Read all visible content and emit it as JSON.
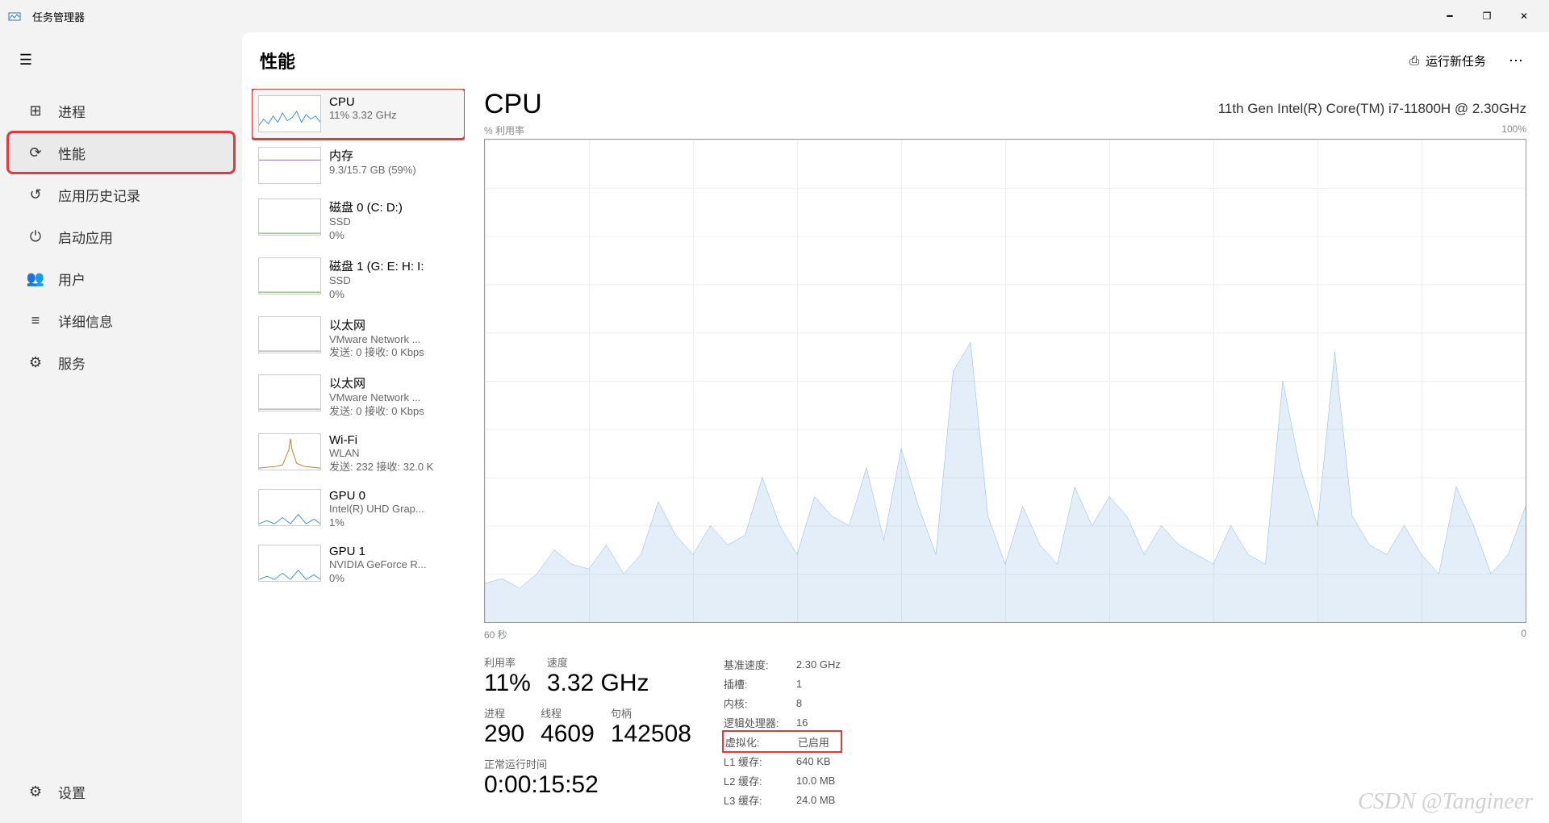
{
  "titlebar": {
    "app_title": "任务管理器"
  },
  "sidebar": {
    "items": [
      {
        "label": "进程"
      },
      {
        "label": "性能"
      },
      {
        "label": "应用历史记录"
      },
      {
        "label": "启动应用"
      },
      {
        "label": "用户"
      },
      {
        "label": "详细信息"
      },
      {
        "label": "服务"
      }
    ],
    "settings": "设置"
  },
  "header": {
    "page_title": "性能",
    "run_task": "运行新任务"
  },
  "perf_list": [
    {
      "title": "CPU",
      "sub": "11%  3.32 GHz",
      "color": "#3a8fd6"
    },
    {
      "title": "内存",
      "sub": "9.3/15.7 GB (59%)",
      "color": "#8a5aa8"
    },
    {
      "title": "磁盘 0 (C: D:)",
      "sub": "SSD",
      "sub2": "0%",
      "color": "#6aa84f"
    },
    {
      "title": "磁盘 1 (G: E: H: I:",
      "sub": "SSD",
      "sub2": "0%",
      "color": "#6aa84f"
    },
    {
      "title": "以太网",
      "sub": "VMware Network ...",
      "sub2": "发送: 0 接收: 0 Kbps",
      "color": "#999"
    },
    {
      "title": "以太网",
      "sub": "VMware Network ...",
      "sub2": "发送: 0 接收: 0 Kbps",
      "color": "#999"
    },
    {
      "title": "Wi-Fi",
      "sub": "WLAN",
      "sub2": "发送: 232 接收: 32.0 K",
      "color": "#c27b2a"
    },
    {
      "title": "GPU 0",
      "sub": "Intel(R) UHD Grap...",
      "sub2": "1%",
      "color": "#3a8fd6"
    },
    {
      "title": "GPU 1",
      "sub": "NVIDIA GeForce R...",
      "sub2": "0%",
      "color": "#3a8fd6"
    }
  ],
  "detail": {
    "title": "CPU",
    "cpu_name": "11th Gen Intel(R) Core(TM) i7-11800H @ 2.30GHz",
    "y_label_left": "% 利用率",
    "y_label_right": "100%",
    "x_label_left": "60 秒",
    "x_label_right": "0",
    "big_stats_r1": [
      {
        "label": "利用率",
        "value": "11%"
      },
      {
        "label": "速度",
        "value": "3.32 GHz"
      }
    ],
    "big_stats_r2": [
      {
        "label": "进程",
        "value": "290"
      },
      {
        "label": "线程",
        "value": "4609"
      },
      {
        "label": "句柄",
        "value": "142508"
      }
    ],
    "uptime_label": "正常运行时间",
    "uptime_value": "0:00:15:52",
    "specs": [
      {
        "key": "基准速度:",
        "val": "2.30 GHz"
      },
      {
        "key": "插槽:",
        "val": "1"
      },
      {
        "key": "内核:",
        "val": "8"
      },
      {
        "key": "逻辑处理器:",
        "val": "16"
      },
      {
        "key": "虚拟化:",
        "val": "已启用",
        "hl": true
      },
      {
        "key": "L1 缓存:",
        "val": "640 KB"
      },
      {
        "key": "L2 缓存:",
        "val": "10.0 MB"
      },
      {
        "key": "L3 缓存:",
        "val": "24.0 MB"
      }
    ]
  },
  "chart_data": {
    "type": "line",
    "title": "CPU % 利用率",
    "xlabel": "秒",
    "ylabel": "% 利用率",
    "xlim": [
      0,
      60
    ],
    "ylim": [
      0,
      100
    ],
    "x": [
      0,
      1,
      2,
      3,
      4,
      5,
      6,
      7,
      8,
      9,
      10,
      11,
      12,
      13,
      14,
      15,
      16,
      17,
      18,
      19,
      20,
      21,
      22,
      23,
      24,
      25,
      26,
      27,
      28,
      29,
      30,
      31,
      32,
      33,
      34,
      35,
      36,
      37,
      38,
      39,
      40,
      41,
      42,
      43,
      44,
      45,
      46,
      47,
      48,
      49,
      50,
      51,
      52,
      53,
      54,
      55,
      56,
      57,
      58,
      59,
      60
    ],
    "values": [
      8,
      9,
      7,
      10,
      15,
      12,
      11,
      16,
      10,
      14,
      25,
      18,
      14,
      20,
      16,
      18,
      30,
      20,
      14,
      26,
      22,
      20,
      32,
      17,
      36,
      24,
      14,
      52,
      58,
      22,
      12,
      24,
      16,
      12,
      28,
      20,
      26,
      22,
      14,
      20,
      16,
      14,
      12,
      20,
      14,
      12,
      50,
      32,
      20,
      56,
      22,
      16,
      14,
      20,
      14,
      10,
      28,
      20,
      10,
      14,
      24
    ]
  },
  "watermark": "CSDN @Tangineer"
}
